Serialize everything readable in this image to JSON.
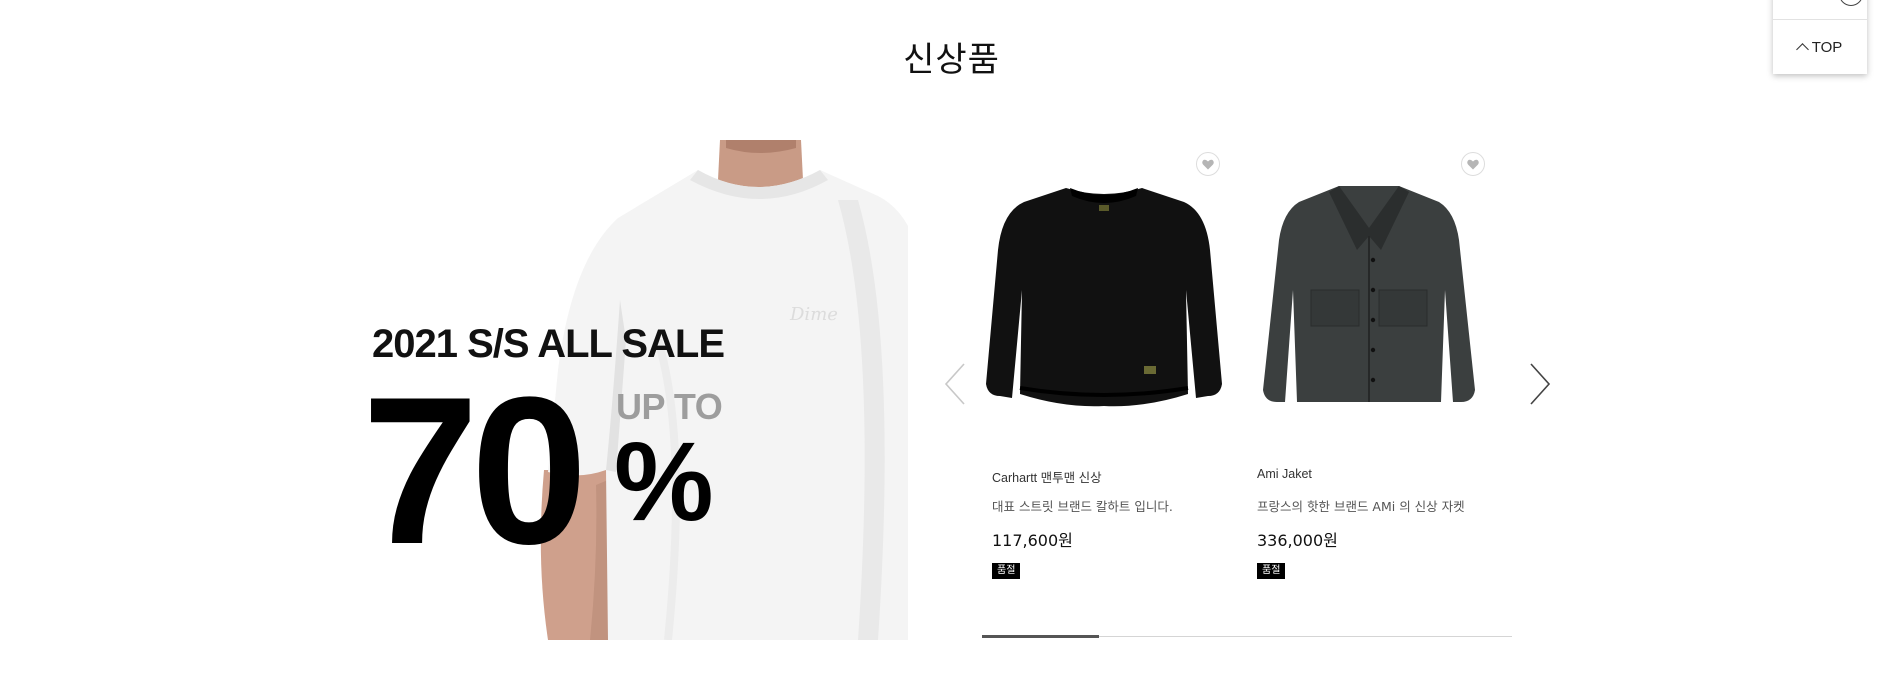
{
  "section": {
    "title": "신상품"
  },
  "floating": {
    "top_label": "TOP"
  },
  "banner": {
    "headline": "2021 S/S  ALL SALE",
    "up_to": "UP TO",
    "percent_value": "70",
    "percent_sign": "%",
    "shirt_logo": "Dime"
  },
  "products": [
    {
      "name": "Carhartt 맨투맨 신상",
      "description": "대표 스트릿 브랜드 칼하트 입니다.",
      "price": "117,600원",
      "badge": "품절",
      "image_icon": "black-sweatshirt",
      "wishlist_icon": "heart-icon"
    },
    {
      "name": "Ami Jaket",
      "description": "프랑스의 핫한 브랜드 AMi 의 신상 자켓",
      "price": "336,000원",
      "badge": "품절",
      "image_icon": "grey-wool-jacket",
      "wishlist_icon": "heart-icon"
    }
  ],
  "slider": {
    "progress": 0.22
  },
  "colors": {
    "badge_bg": "#000000",
    "accent_text": "#111111",
    "upto_grey": "#9d9d9d"
  }
}
